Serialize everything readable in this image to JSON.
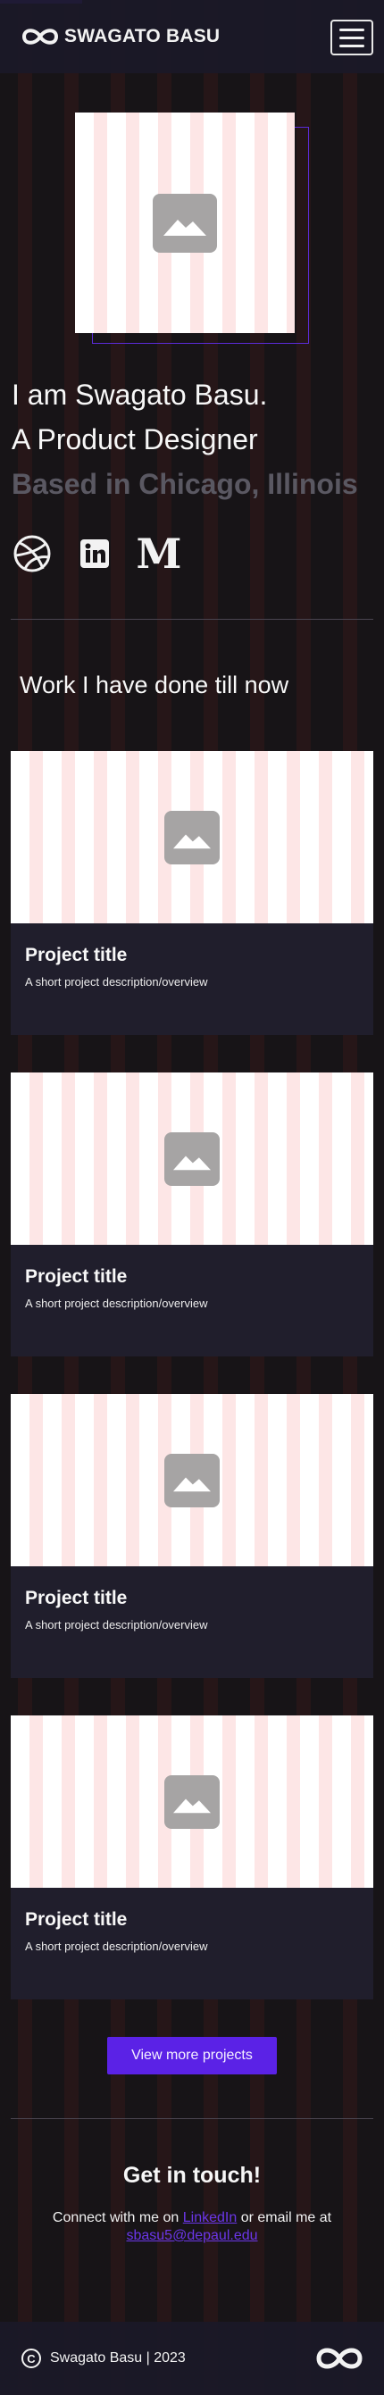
{
  "header": {
    "brand": "SWAGATO BASU",
    "logo_icon": "infinity-logo-icon",
    "menu_icon": "hamburger-menu-icon"
  },
  "hero": {
    "image_icon": "image-placeholder-icon",
    "line1": "I am Swagato Basu.",
    "line2": "A Product Designer",
    "line3": "Based in Chicago, Illinois"
  },
  "socials": [
    {
      "name": "dribbble",
      "icon": "dribbble-icon"
    },
    {
      "name": "linkedin",
      "icon": "linkedin-icon"
    },
    {
      "name": "medium",
      "icon": "medium-icon",
      "glyph": "M"
    }
  ],
  "work": {
    "title": "Work I have done till now",
    "projects": [
      {
        "title": "Project title",
        "description": "A short project description/overview"
      },
      {
        "title": "Project title",
        "description": "A short project description/overview"
      },
      {
        "title": "Project title",
        "description": "A short project description/overview"
      },
      {
        "title": "Project title",
        "description": "A short project description/overview"
      }
    ],
    "view_more": "View more projects"
  },
  "contact": {
    "title": "Get in touch!",
    "text_before": "Connect with me on ",
    "linkedin_label": "LinkedIn",
    "text_middle": " or email me at",
    "email": "sbasu5@depaul.edu"
  },
  "footer": {
    "copyright_symbol": "C",
    "text": "Swagato Basu | 2023"
  },
  "colors": {
    "accent": "#5b22e6",
    "background": "#171417",
    "stripe": "#261618",
    "muted_text": "#5a5862"
  }
}
